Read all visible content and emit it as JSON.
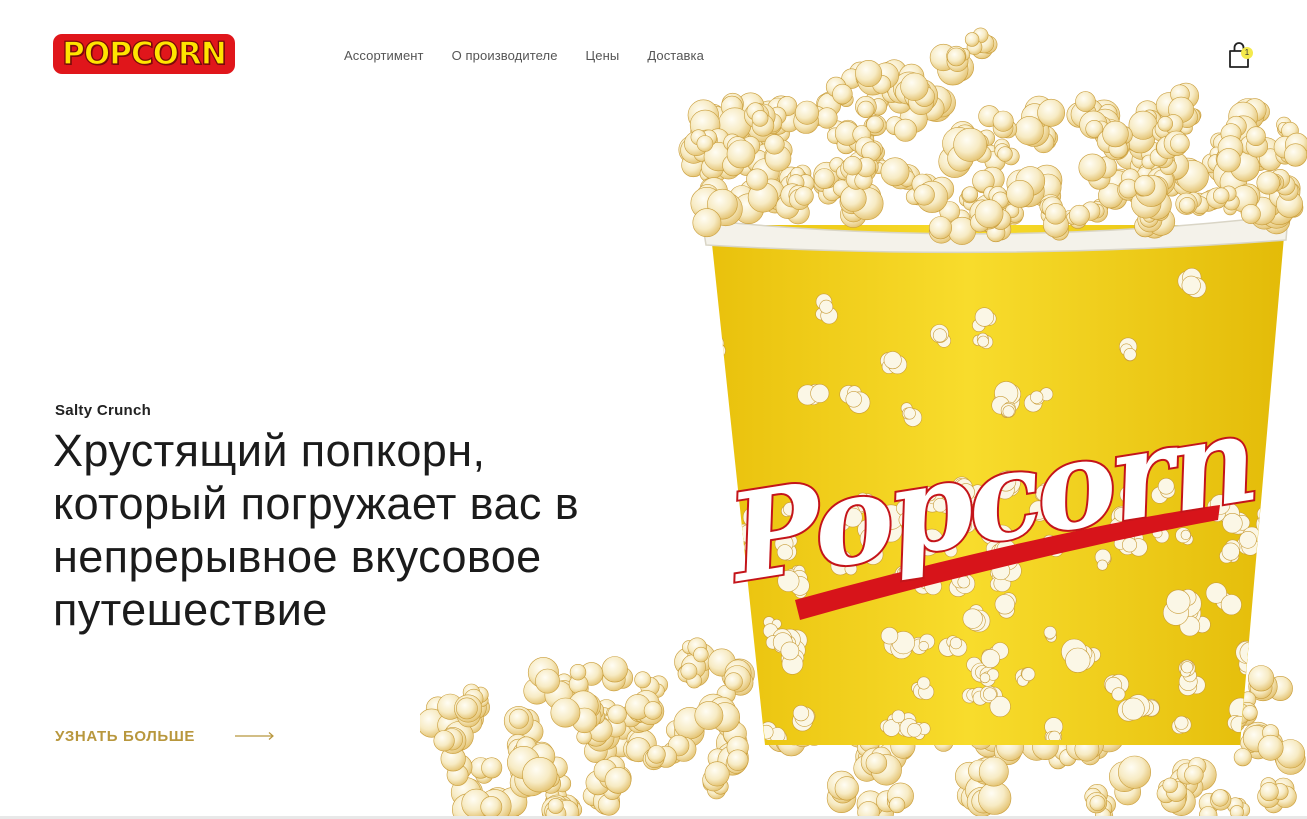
{
  "header": {
    "logo_text": "POPCORN",
    "nav": [
      {
        "label": "Ассортимент"
      },
      {
        "label": "О производителе"
      },
      {
        "label": "Цены"
      },
      {
        "label": "Доставка"
      }
    ],
    "cart": {
      "icon": "shopping-bag-icon",
      "count": "1"
    }
  },
  "hero": {
    "eyebrow": "Salty Crunch",
    "headline": "Хрустящий попкорн, который погружает вас в непрерывное вкусовое путешествие",
    "cta_label": "УЗНАТЬ БОЛЬШЕ",
    "cta_icon": "arrow-right-icon",
    "image_text": "Popcorn"
  },
  "colors": {
    "accent_gold": "#b8973d",
    "logo_red": "#e0161b",
    "logo_yellow": "#ffe400",
    "badge_yellow": "#f4ea4c",
    "bucket_yellow": "#f3d21c"
  }
}
